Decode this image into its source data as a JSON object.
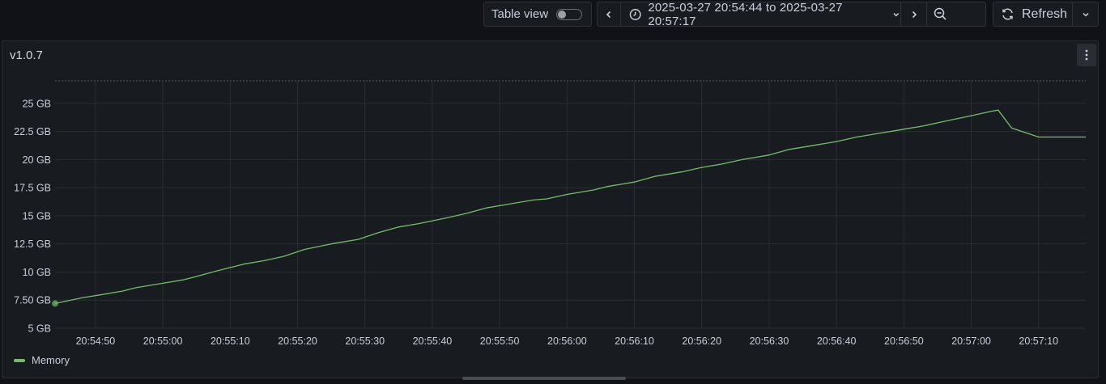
{
  "toolbar": {
    "table_view_label": "Table view",
    "table_view_on": false,
    "time_range": "2025-03-27 20:54:44 to 2025-03-27 20:57:17",
    "refresh_label": "Refresh"
  },
  "panel": {
    "title": "v1.0.7"
  },
  "colors": {
    "series": "#73bf69",
    "background": "#111217",
    "panel": "#181b1f"
  },
  "chart_data": {
    "type": "line",
    "title": "v1.0.7",
    "xlabel": "",
    "ylabel": "",
    "ylim": [
      5,
      27
    ],
    "y_ticks": [
      "5 GB",
      "7.50 GB",
      "10 GB",
      "12.5 GB",
      "15 GB",
      "17.5 GB",
      "20 GB",
      "22.5 GB",
      "25 GB"
    ],
    "y_tick_values": [
      5,
      7.5,
      10,
      12.5,
      15,
      17.5,
      20,
      22.5,
      25
    ],
    "x_ticks": [
      "20:54:50",
      "20:55:00",
      "20:55:10",
      "20:55:20",
      "20:55:30",
      "20:55:40",
      "20:55:50",
      "20:56:00",
      "20:56:10",
      "20:56:20",
      "20:56:30",
      "20:56:40",
      "20:56:50",
      "20:57:00",
      "20:57:10"
    ],
    "x_tick_values": [
      "20:54:50",
      "20:55:00",
      "20:55:10",
      "20:55:20",
      "20:55:30",
      "20:55:40",
      "20:55:50",
      "20:56:00",
      "20:56:10",
      "20:56:20",
      "20:56:30",
      "20:56:40",
      "20:56:50",
      "20:57:00",
      "20:57:10"
    ],
    "xlim": [
      "20:54:44",
      "20:57:17"
    ],
    "grid": true,
    "legend": "bottom-left",
    "series": [
      {
        "name": "Memory",
        "unit": "GB",
        "x": [
          "20:54:44",
          "20:54:48",
          "20:54:51",
          "20:54:54",
          "20:54:56",
          "20:55:00",
          "20:55:03",
          "20:55:05",
          "20:55:08",
          "20:55:12",
          "20:55:15",
          "20:55:18",
          "20:55:21",
          "20:55:25",
          "20:55:29",
          "20:55:32",
          "20:55:35",
          "20:55:38",
          "20:55:42",
          "20:55:45",
          "20:55:48",
          "20:55:51",
          "20:55:55",
          "20:55:57",
          "20:56:00",
          "20:56:04",
          "20:56:06",
          "20:56:10",
          "20:56:13",
          "20:56:17",
          "20:56:20",
          "20:56:23",
          "20:56:26",
          "20:56:30",
          "20:56:33",
          "20:56:36",
          "20:56:40",
          "20:56:43",
          "20:56:46",
          "20:56:50",
          "20:56:53",
          "20:56:56",
          "20:57:00",
          "20:57:03",
          "20:57:04",
          "20:57:06",
          "20:57:10",
          "20:57:17"
        ],
        "y": [
          7.2,
          7.7,
          8.0,
          8.3,
          8.6,
          9.0,
          9.3,
          9.6,
          10.1,
          10.7,
          11.0,
          11.4,
          12.0,
          12.5,
          12.9,
          13.5,
          14.0,
          14.3,
          14.8,
          15.2,
          15.7,
          16.0,
          16.4,
          16.5,
          16.9,
          17.3,
          17.6,
          18.0,
          18.5,
          18.9,
          19.3,
          19.6,
          20.0,
          20.4,
          20.9,
          21.2,
          21.6,
          22.0,
          22.3,
          22.7,
          23.0,
          23.4,
          23.9,
          24.3,
          24.4,
          22.8,
          22.0,
          22.0
        ]
      }
    ]
  }
}
